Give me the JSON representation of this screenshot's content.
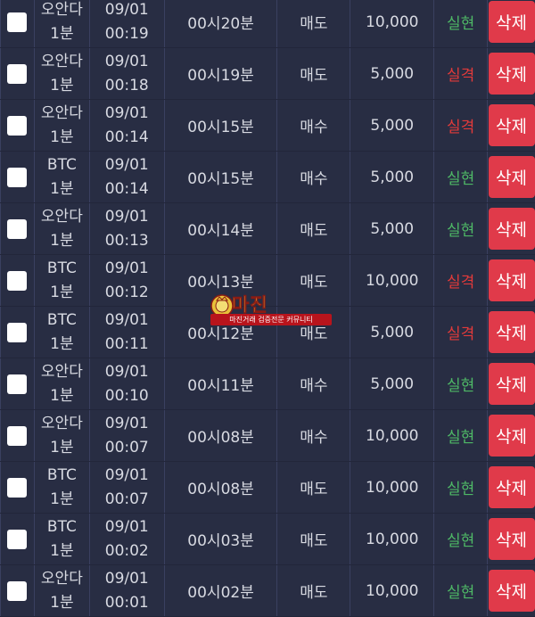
{
  "colors": {
    "background": "#22263a",
    "row": "#282d43",
    "win": "#4eb866",
    "lose": "#e23a3a",
    "delete_button": "#e03a4a"
  },
  "rows": [
    {
      "market_line1": "오안다",
      "market_line2": "1분",
      "date": "09/01",
      "clock": "00:19",
      "round": "00시20분",
      "side": "매도",
      "amount": "10,000",
      "result": "실현",
      "result_type": "win",
      "action_label": "삭제"
    },
    {
      "market_line1": "오안다",
      "market_line2": "1분",
      "date": "09/01",
      "clock": "00:18",
      "round": "00시19분",
      "side": "매도",
      "amount": "5,000",
      "result": "실격",
      "result_type": "lose",
      "action_label": "삭제"
    },
    {
      "market_line1": "오안다",
      "market_line2": "1분",
      "date": "09/01",
      "clock": "00:14",
      "round": "00시15분",
      "side": "매수",
      "amount": "5,000",
      "result": "실격",
      "result_type": "lose",
      "action_label": "삭제"
    },
    {
      "market_line1": "BTC",
      "market_line2": "1분",
      "date": "09/01",
      "clock": "00:14",
      "round": "00시15분",
      "side": "매수",
      "amount": "5,000",
      "result": "실현",
      "result_type": "win",
      "action_label": "삭제"
    },
    {
      "market_line1": "오안다",
      "market_line2": "1분",
      "date": "09/01",
      "clock": "00:13",
      "round": "00시14분",
      "side": "매도",
      "amount": "5,000",
      "result": "실현",
      "result_type": "win",
      "action_label": "삭제"
    },
    {
      "market_line1": "BTC",
      "market_line2": "1분",
      "date": "09/01",
      "clock": "00:12",
      "round": "00시13분",
      "side": "매도",
      "amount": "10,000",
      "result": "실격",
      "result_type": "lose",
      "action_label": "삭제"
    },
    {
      "market_line1": "BTC",
      "market_line2": "1분",
      "date": "09/01",
      "clock": "00:11",
      "round": "00시12분",
      "side": "매도",
      "amount": "5,000",
      "result": "실격",
      "result_type": "lose",
      "action_label": "삭제"
    },
    {
      "market_line1": "오안다",
      "market_line2": "1분",
      "date": "09/01",
      "clock": "00:10",
      "round": "00시11분",
      "side": "매수",
      "amount": "5,000",
      "result": "실현",
      "result_type": "win",
      "action_label": "삭제"
    },
    {
      "market_line1": "오안다",
      "market_line2": "1분",
      "date": "09/01",
      "clock": "00:07",
      "round": "00시08분",
      "side": "매수",
      "amount": "10,000",
      "result": "실현",
      "result_type": "win",
      "action_label": "삭제"
    },
    {
      "market_line1": "BTC",
      "market_line2": "1분",
      "date": "09/01",
      "clock": "00:07",
      "round": "00시08분",
      "side": "매도",
      "amount": "10,000",
      "result": "실현",
      "result_type": "win",
      "action_label": "삭제"
    },
    {
      "market_line1": "BTC",
      "market_line2": "1분",
      "date": "09/01",
      "clock": "00:02",
      "round": "00시03분",
      "side": "매도",
      "amount": "10,000",
      "result": "실현",
      "result_type": "win",
      "action_label": "삭제"
    },
    {
      "market_line1": "오안다",
      "market_line2": "1분",
      "date": "09/01",
      "clock": "00:01",
      "round": "00시02분",
      "side": "매도",
      "amount": "10,000",
      "result": "실현",
      "result_type": "win",
      "action_label": "삭제"
    }
  ],
  "watermark": {
    "brand": "마진",
    "tagline": "마진거래 검증전문 커뮤니티"
  }
}
